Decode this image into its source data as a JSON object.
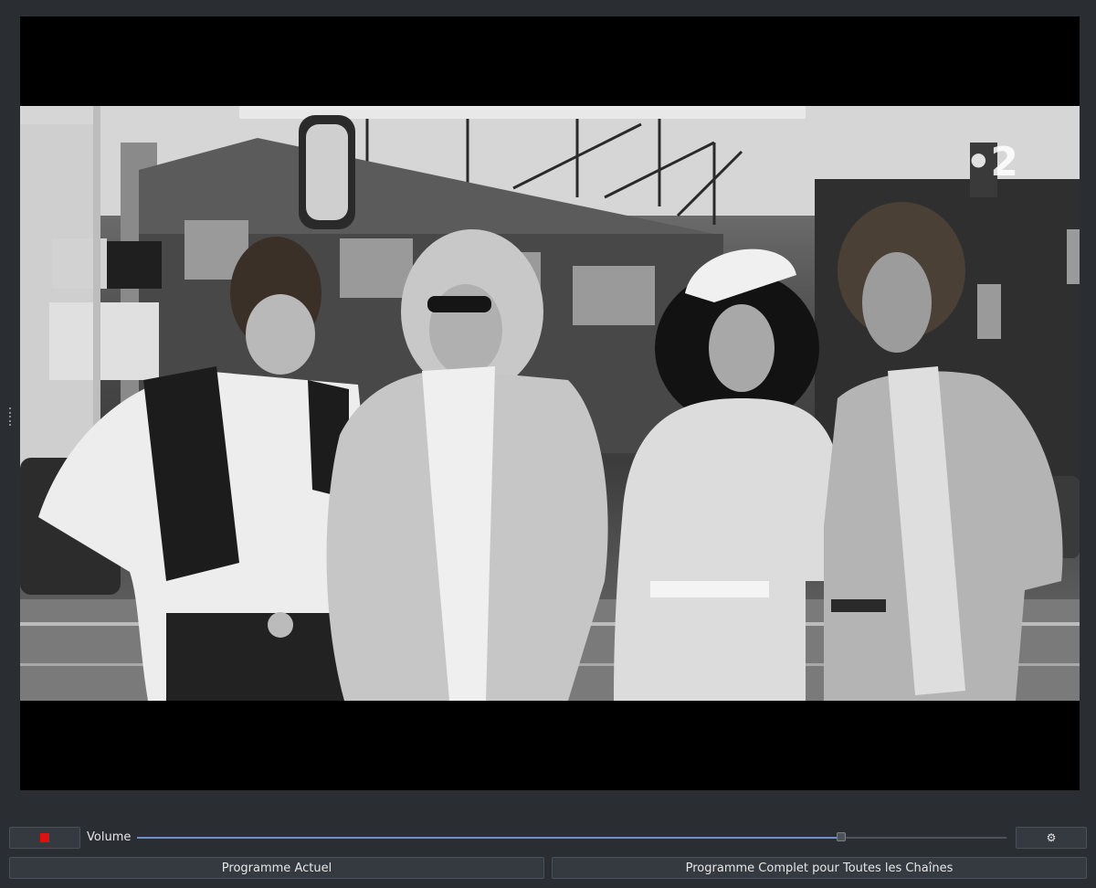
{
  "video": {
    "channel_logo": "•2",
    "scene": "black-and-white photograph of four people standing on a street"
  },
  "controls": {
    "stop_icon": "stop-icon",
    "stop_color": "#e01010",
    "volume_label": "Volume",
    "volume_level": 0.81,
    "settings_glyph": "⚙",
    "settings_icon": "gear-icon"
  },
  "buttons": {
    "current_program": "Programme Actuel",
    "full_program": "Programme Complet pour Toutes les Chaînes"
  },
  "colors": {
    "background": "#2a2e33",
    "accent": "#6f8fd0"
  }
}
